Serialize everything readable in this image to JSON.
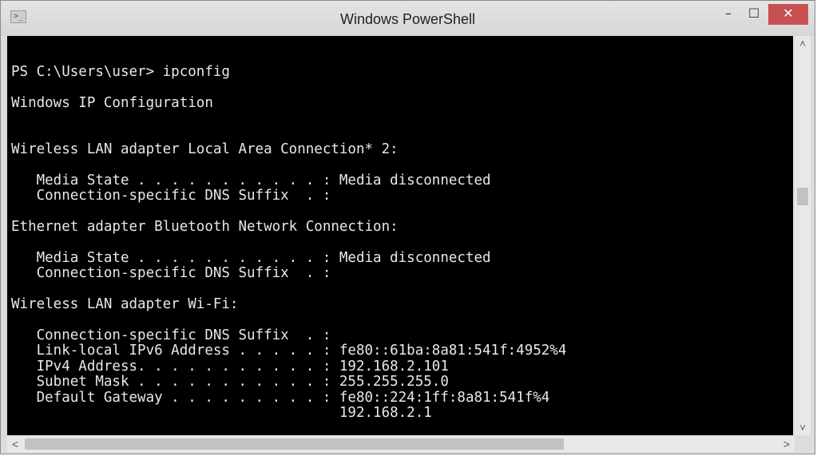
{
  "window": {
    "title": "Windows PowerShell",
    "icon": "powershell-icon",
    "controls": {
      "minimize": "–",
      "maximize": "☐",
      "close": "✕"
    }
  },
  "console": {
    "text": "PS C:\\Users\\user> ipconfig\n\nWindows IP Configuration\n\n\nWireless LAN adapter Local Area Connection* 2:\n\n   Media State . . . . . . . . . . . : Media disconnected\n   Connection-specific DNS Suffix  . :\n\nEthernet adapter Bluetooth Network Connection:\n\n   Media State . . . . . . . . . . . : Media disconnected\n   Connection-specific DNS Suffix  . :\n\nWireless LAN adapter Wi-Fi:\n\n   Connection-specific DNS Suffix  . :\n   Link-local IPv6 Address . . . . . : fe80::61ba:8a81:541f:4952%4\n   IPv4 Address. . . . . . . . . . . : 192.168.2.101\n   Subnet Mask . . . . . . . . . . . : 255.255.255.0\n   Default Gateway . . . . . . . . . : fe80::224:1ff:8a81:541f%4\n                                       192.168.2.1",
    "colors": {
      "background": "#000000",
      "foreground": "#e8e8e8"
    }
  },
  "scrollbars": {
    "vertical": {
      "up": "˄",
      "down": "˅"
    },
    "horizontal": {
      "left": "<",
      "right": ">"
    }
  }
}
